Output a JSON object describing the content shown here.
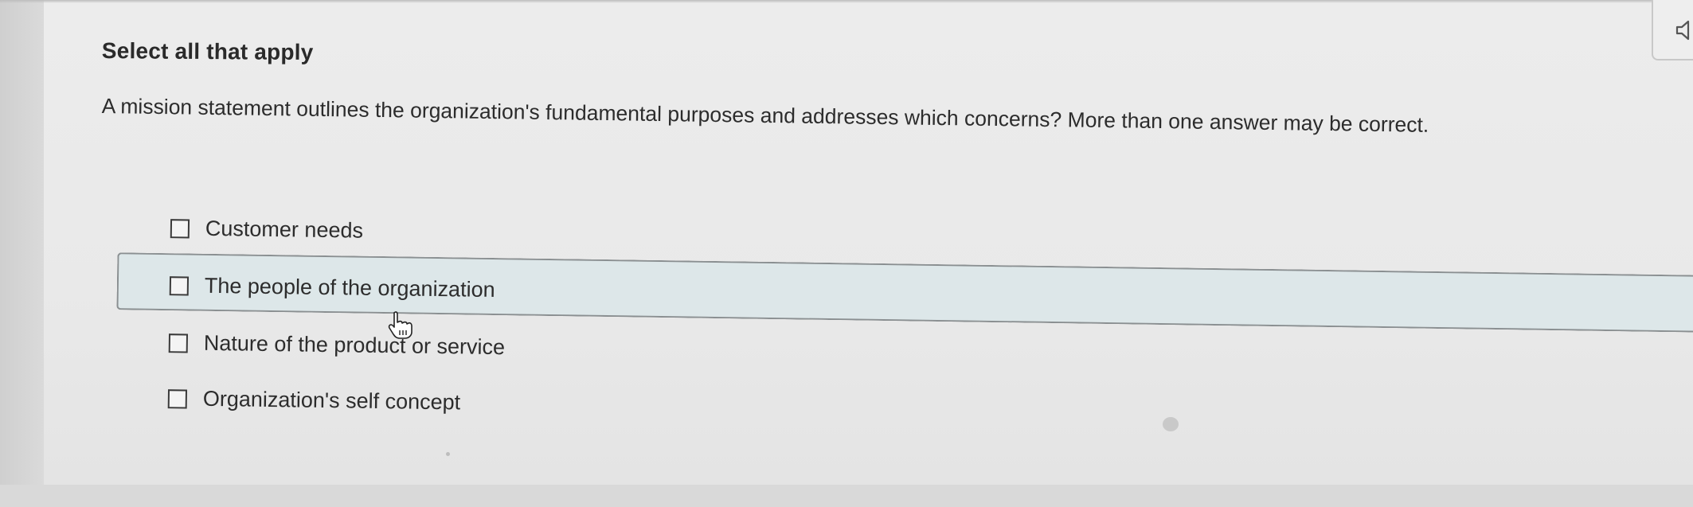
{
  "question": {
    "heading": "Select all that apply",
    "prompt": "A mission statement outlines the organization's fundamental purposes and addresses which concerns? More than one answer may be correct."
  },
  "options": [
    {
      "label": "Customer needs",
      "checked": false,
      "highlighted": false
    },
    {
      "label": "The people of the organization",
      "checked": false,
      "highlighted": true
    },
    {
      "label": "Nature of the product or service",
      "checked": false,
      "highlighted": false
    },
    {
      "label": "Organization's self concept",
      "checked": false,
      "highlighted": false
    }
  ],
  "colors": {
    "highlight_background": "#dde7e9",
    "highlight_border": "#8a8f91",
    "text": "#2c2c2c"
  },
  "icons": {
    "audio": "speaker-icon",
    "cursor": "hand-pointer-icon"
  }
}
